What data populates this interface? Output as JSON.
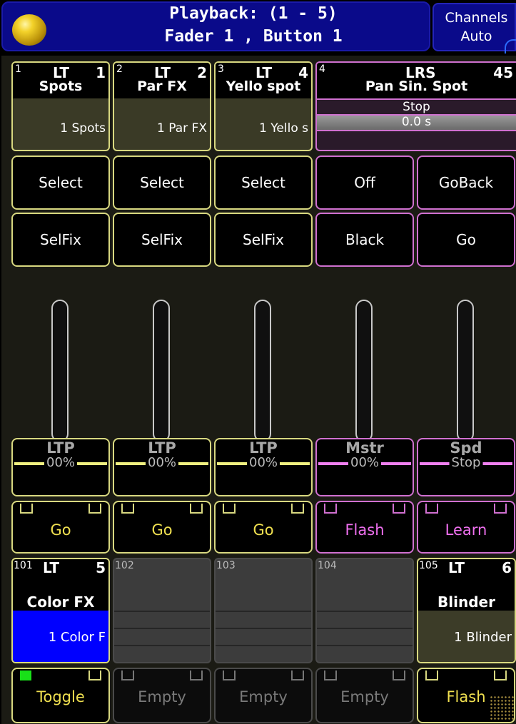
{
  "header": {
    "title_line1": "Playback: (1 - 5)",
    "title_line2": "Fader  1 , Button  1",
    "channels_label": "Channels",
    "channels_mode": "Auto"
  },
  "executors": [
    {
      "num": "1",
      "type": "LT",
      "page": "1",
      "name": "Spots",
      "cue": "1 Spots"
    },
    {
      "num": "2",
      "type": "LT",
      "page": "2",
      "name": "Par FX",
      "cue": "1 Par FX"
    },
    {
      "num": "3",
      "type": "LT",
      "page": "4",
      "name": "Yello spot",
      "cue": "1 Yello s"
    },
    {
      "num": "4",
      "type": "LRS",
      "page": "45",
      "name": "Pan Sin. Spot",
      "status": "Stop",
      "time": "0.0 s"
    }
  ],
  "row1_buttons": [
    "Select",
    "Select",
    "Select",
    "Off",
    "GoBack"
  ],
  "row2_buttons": [
    "SelFix",
    "SelFix",
    "SelFix",
    "Black",
    "Go"
  ],
  "faders": [
    {
      "label": "LTP",
      "value": "00%"
    },
    {
      "label": "LTP",
      "value": "00%"
    },
    {
      "label": "LTP",
      "value": "00%"
    },
    {
      "label": "Mstr",
      "value": "00%"
    },
    {
      "label": "Spd",
      "value": "Stop"
    }
  ],
  "go_buttons": [
    "Go",
    "Go",
    "Go",
    "Flash",
    "Learn"
  ],
  "lower_executors": [
    {
      "num": "101",
      "type": "LT",
      "page": "5",
      "name": "Color FX",
      "cue": "1 Color F"
    },
    {
      "num": "102"
    },
    {
      "num": "103"
    },
    {
      "num": "104"
    },
    {
      "num": "105",
      "type": "LT",
      "page": "6",
      "name": "Blinder",
      "cue": "1 Blinder"
    }
  ],
  "bottom_buttons": [
    "Toggle",
    "Empty",
    "Empty",
    "Empty",
    "Flash"
  ],
  "colors": {
    "yellow_border": "#d8d880",
    "pink_border": "#d070d0",
    "header_blue": "#0a0a8a",
    "cue_blue": "#0000ff",
    "led_green": "#18e018"
  }
}
